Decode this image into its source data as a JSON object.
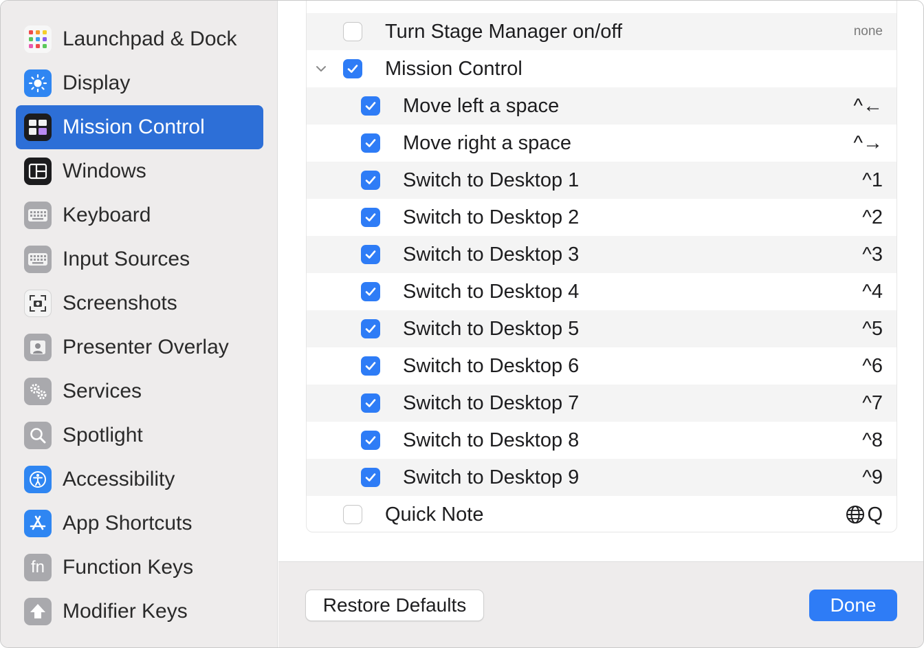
{
  "sidebar": {
    "items": [
      {
        "label": "Launchpad & Dock",
        "icon": "launchpad-icon",
        "active": false
      },
      {
        "label": "Display",
        "icon": "display-icon",
        "active": false
      },
      {
        "label": "Mission Control",
        "icon": "mission-control-icon",
        "active": true
      },
      {
        "label": "Windows",
        "icon": "windows-icon",
        "active": false
      },
      {
        "label": "Keyboard",
        "icon": "keyboard-icon",
        "active": false
      },
      {
        "label": "Input Sources",
        "icon": "input-sources-icon",
        "active": false
      },
      {
        "label": "Screenshots",
        "icon": "screenshots-icon",
        "active": false
      },
      {
        "label": "Presenter Overlay",
        "icon": "presenter-overlay-icon",
        "active": false
      },
      {
        "label": "Services",
        "icon": "services-icon",
        "active": false
      },
      {
        "label": "Spotlight",
        "icon": "spotlight-icon",
        "active": false
      },
      {
        "label": "Accessibility",
        "icon": "accessibility-icon",
        "active": false
      },
      {
        "label": "App Shortcuts",
        "icon": "app-shortcuts-icon",
        "active": false
      },
      {
        "label": "Function Keys",
        "icon": "function-keys-icon",
        "active": false
      },
      {
        "label": "Modifier Keys",
        "icon": "modifier-keys-icon",
        "active": false
      }
    ]
  },
  "shortcuts": {
    "rows": [
      {
        "label": "Turn Stage Manager on/off",
        "key": "none",
        "checked": false
      },
      {
        "label": "Mission Control",
        "key": "",
        "checked": true
      },
      {
        "label": "Move left a space",
        "key": "^←",
        "checked": true
      },
      {
        "label": "Move right a space",
        "key": "^→",
        "checked": true
      },
      {
        "label": "Switch to Desktop 1",
        "key": "^1",
        "checked": true
      },
      {
        "label": "Switch to Desktop 2",
        "key": "^2",
        "checked": true
      },
      {
        "label": "Switch to Desktop 3",
        "key": "^3",
        "checked": true
      },
      {
        "label": "Switch to Desktop 4",
        "key": "^4",
        "checked": true
      },
      {
        "label": "Switch to Desktop 5",
        "key": "^5",
        "checked": true
      },
      {
        "label": "Switch to Desktop 6",
        "key": "^6",
        "checked": true
      },
      {
        "label": "Switch to Desktop 7",
        "key": "^7",
        "checked": true
      },
      {
        "label": "Switch to Desktop 8",
        "key": "^8",
        "checked": true
      },
      {
        "label": "Switch to Desktop 9",
        "key": "^9",
        "checked": true
      },
      {
        "label": "Quick Note",
        "key": "Q",
        "checked": false
      }
    ]
  },
  "footer": {
    "restore_label": "Restore Defaults",
    "done_label": "Done"
  },
  "colors": {
    "accent": "#2e7cf6",
    "sidebar_active": "#2d6fd7"
  }
}
